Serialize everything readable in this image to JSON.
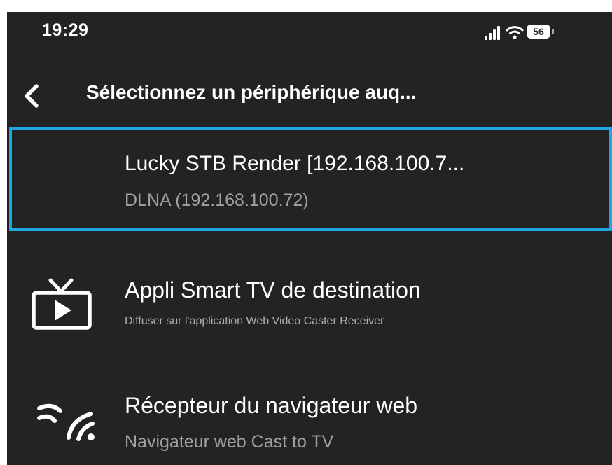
{
  "status_bar": {
    "time": "19:29",
    "battery": "56",
    "icons": [
      "signal-icon",
      "wifi-icon",
      "battery-icon"
    ]
  },
  "nav": {
    "back_icon": "chevron-left-icon",
    "title": "Sélectionnez un périphérique auq..."
  },
  "devices": [
    {
      "title": "Lucky STB Render  [192.168.100.7...",
      "subtitle": "DLNA  (192.168.100.72)",
      "selected": true
    },
    {
      "icon": "tv-icon",
      "title": "Appli Smart TV de destination",
      "subtitle": "Diffuser sur l'application Web Video Caster Receiver"
    },
    {
      "icon": "cast-icon",
      "title": "Récepteur du navigateur web",
      "subtitle": "Navigateur web Cast to TV"
    }
  ],
  "colors": {
    "background": "#232323",
    "selection_border": "#1ea5e4",
    "primary_text": "#ffffff",
    "secondary_text": "#a0a0a0"
  }
}
